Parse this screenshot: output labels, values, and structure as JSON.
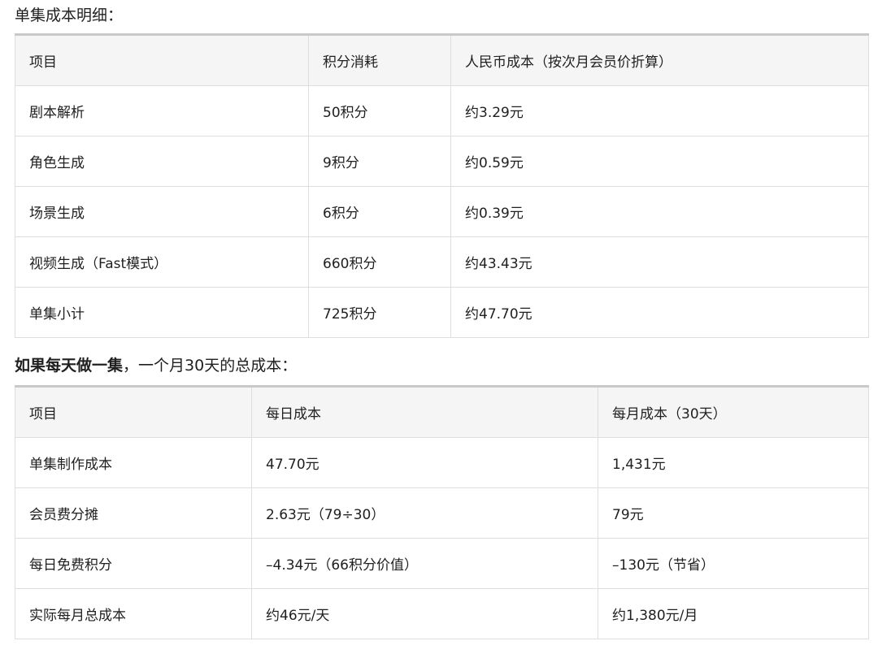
{
  "section1": {
    "heading": "单集成本明细：",
    "headers": [
      "项目",
      "积分消耗",
      "人民币成本（按次月会员价折算）"
    ],
    "rows": [
      [
        "剧本解析",
        "50积分",
        "约3.29元"
      ],
      [
        "角色生成",
        "9积分",
        "约0.59元"
      ],
      [
        "场景生成",
        "6积分",
        "约0.39元"
      ],
      [
        "视频生成（Fast模式）",
        "660积分",
        "约43.43元"
      ],
      [
        "单集小计",
        "725积分",
        "约47.70元"
      ]
    ]
  },
  "section2": {
    "heading_bold": "如果每天做一集",
    "heading_rest": "，一个月30天的总成本：",
    "headers": [
      "项目",
      "每日成本",
      "每月成本（30天）"
    ],
    "rows": [
      [
        "单集制作成本",
        "47.70元",
        "1,431元"
      ],
      [
        "会员费分摊",
        "2.63元（79÷30）",
        "79元"
      ],
      [
        "每日免费积分",
        "–4.34元（66积分价值）",
        "–130元（节省）"
      ],
      [
        "实际每月总成本",
        "约46元/天",
        "约1,380元/月"
      ]
    ]
  }
}
